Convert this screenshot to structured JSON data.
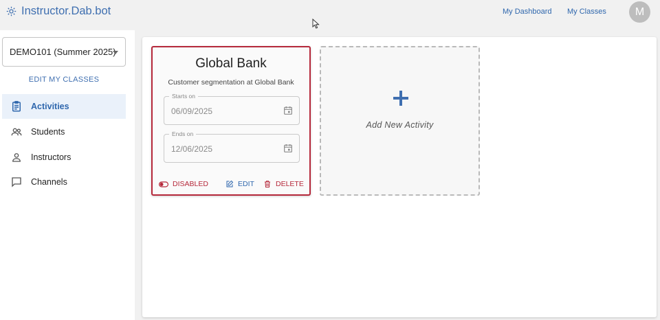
{
  "header": {
    "brand": "Instructor.Dab.bot",
    "links": [
      "My Dashboard",
      "My Classes"
    ],
    "avatar_letter": "M"
  },
  "sidebar": {
    "class_selector": "DEMO101 (Summer 2025)",
    "edit_classes": "EDIT MY CLASSES",
    "items": [
      {
        "label": "Activities",
        "icon": "clipboard-icon",
        "active": true
      },
      {
        "label": "Students",
        "icon": "people-icon"
      },
      {
        "label": "Instructors",
        "icon": "person-icon"
      },
      {
        "label": "Channels",
        "icon": "chat-icon"
      }
    ]
  },
  "activity_card": {
    "title": "Global Bank",
    "description": "Customer segmentation at Global Bank",
    "starts_label": "Starts on",
    "starts_value": "06/09/2025",
    "ends_label": "Ends on",
    "ends_value": "12/06/2025",
    "actions": {
      "disabled": "DISABLED",
      "edit": "EDIT",
      "delete": "DELETE"
    }
  },
  "add_card": {
    "label": "Add New Activity"
  },
  "colors": {
    "accent": "#2f67ad",
    "danger": "#b5283a",
    "active_bg": "#eaf1fa"
  }
}
